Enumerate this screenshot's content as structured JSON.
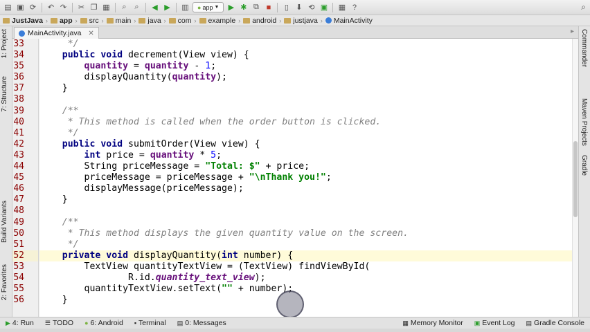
{
  "toolbar": {
    "run_config": "app",
    "icons": [
      "open-icon",
      "save-icon",
      "sync-icon",
      "undo-icon",
      "redo-icon",
      "cut-icon",
      "copy-icon",
      "paste-icon",
      "find-icon",
      "replace-icon",
      "back-icon",
      "forward-icon",
      "make-icon",
      "run-icon",
      "debug-icon",
      "attach-icon",
      "stop-icon",
      "avd-icon",
      "sdk-icon",
      "gradle-sync-icon",
      "device-monitor-icon",
      "project-structure-icon",
      "help-icon",
      "search-everywhere-icon"
    ]
  },
  "breadcrumb": [
    "JustJava",
    "app",
    "src",
    "main",
    "java",
    "com",
    "example",
    "android",
    "justjava",
    "MainActivity"
  ],
  "editor_tab": {
    "label": "MainActivity.java"
  },
  "left_tools": {
    "project": "1: Project",
    "structure": "7: Structure",
    "build_variants": "Build Variants",
    "favorites": "2: Favorites"
  },
  "right_tools": {
    "commander": "Commander",
    "maven": "Maven Projects",
    "gradle": "Gradle"
  },
  "code": {
    "line_numbers": [
      "33",
      "34",
      "35",
      "36",
      "37",
      "38",
      "39",
      "40",
      "41",
      "42",
      "43",
      "44",
      "45",
      "46",
      "47",
      "48",
      "49",
      "50",
      "51",
      "52",
      "53",
      "54",
      "55",
      "56"
    ],
    "current_line": "52"
  },
  "bottom_tabs": {
    "run": "4: Run",
    "todo": "TODO",
    "android": "6: Android",
    "terminal": "Terminal",
    "messages": "0: Messages",
    "memory": "Memory Monitor",
    "event_log": "Event Log",
    "gradle_console": "Gradle Console"
  }
}
